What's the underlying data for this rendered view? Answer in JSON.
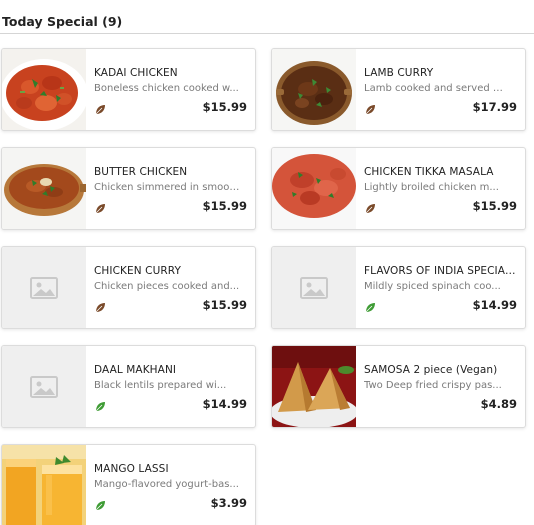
{
  "section": {
    "title": "Today Special (9)"
  },
  "colors": {
    "veg": "#3f9c35",
    "nonveg": "#7a4a2a",
    "placeholder_bg": "#efefef",
    "placeholder_icon": "#c9c9c9"
  },
  "items": [
    {
      "name": "KADAI CHICKEN",
      "desc": "Boneless chicken cooked w...",
      "price": "$15.99",
      "diet": "nonveg",
      "image": "kadai-chicken-photo"
    },
    {
      "name": "LAMB CURRY",
      "desc": "Lamb cooked and served wi...",
      "price": "$17.99",
      "diet": "nonveg",
      "image": "lamb-curry-photo"
    },
    {
      "name": "BUTTER CHICKEN",
      "desc": "Chicken simmered in smoot...",
      "price": "$15.99",
      "diet": "nonveg",
      "image": "butter-chicken-photo"
    },
    {
      "name": "CHICKEN TIKKA MASALA",
      "desc": "Lightly broiled chicken m...",
      "price": "$15.99",
      "diet": "nonveg",
      "image": "chicken-tikka-masala-photo"
    },
    {
      "name": "CHICKEN CURRY",
      "desc": "Chicken pieces cooked and...",
      "price": "$15.99",
      "diet": "nonveg",
      "image": "placeholder"
    },
    {
      "name": "FLAVORS OF INDIA SPECIAL ...",
      "desc": "Mildly spiced spinach coo...",
      "price": "$14.99",
      "diet": "veg",
      "image": "placeholder"
    },
    {
      "name": "DAAL MAKHANI",
      "desc": "Black lentils prepared wi...",
      "price": "$14.99",
      "diet": "veg",
      "image": "placeholder"
    },
    {
      "name": "SAMOSA 2 piece (Vegan)",
      "desc": "Two Deep fried crispy pas...",
      "price": "$4.89",
      "diet": "",
      "image": "samosa-photo"
    },
    {
      "name": "MANGO LASSI",
      "desc": "Mango-flavored yogurt-bas...",
      "price": "$3.99",
      "diet": "veg",
      "image": "mango-lassi-photo"
    }
  ]
}
